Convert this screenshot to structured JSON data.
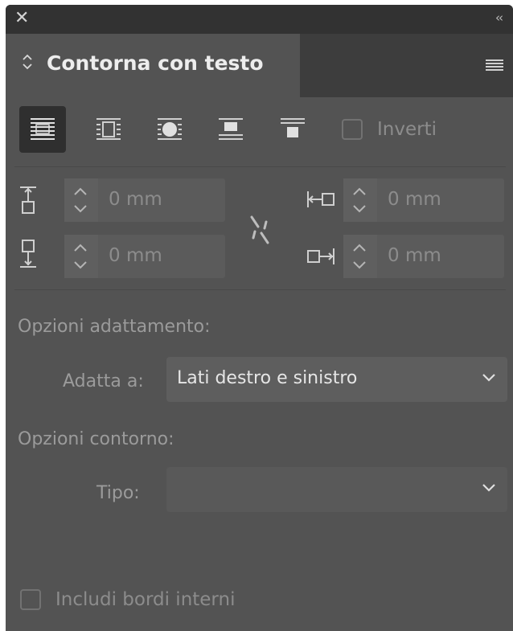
{
  "window": {
    "close_icon": "close-icon",
    "collapse_icon": "double-chevron-left-icon",
    "colors": {
      "panel_bg": "#535353",
      "topbar_bg": "#323232",
      "tabstrip_bg": "#3d3d3d",
      "input_bg": "#5b5b5b"
    }
  },
  "panel": {
    "title": "Contorna con testo",
    "tab_arrows_icon": "up-down-arrows-icon",
    "menu_icon": "panel-menu-icon"
  },
  "wrap_types": {
    "buttons": [
      {
        "icon": "no-text-wrap-icon",
        "selected": true
      },
      {
        "icon": "wrap-around-bounding-box-icon",
        "selected": false
      },
      {
        "icon": "wrap-around-object-shape-icon",
        "selected": false
      },
      {
        "icon": "jump-object-icon",
        "selected": false
      },
      {
        "icon": "jump-to-next-column-icon",
        "selected": false
      }
    ],
    "invert_label": "Inverti",
    "invert_checked": false
  },
  "offsets": {
    "top": {
      "value": "0 mm",
      "icon": "top-offset-icon"
    },
    "bottom": {
      "value": "0 mm",
      "icon": "bottom-offset-icon"
    },
    "left": {
      "value": "0 mm",
      "icon": "left-offset-icon"
    },
    "right": {
      "value": "0 mm",
      "icon": "right-offset-icon"
    },
    "link_icon": "unlinked-chain-icon"
  },
  "wrap_options": {
    "section_label": "Opzioni adattamento:",
    "wrap_to_label": "Adatta a:",
    "wrap_to_value": "Lati destro e sinistro"
  },
  "contour_options": {
    "section_label": "Opzioni contorno:",
    "type_label": "Tipo:",
    "type_value": ""
  },
  "include_inside_edges": {
    "label": "Includi bordi interni",
    "checked": false
  }
}
